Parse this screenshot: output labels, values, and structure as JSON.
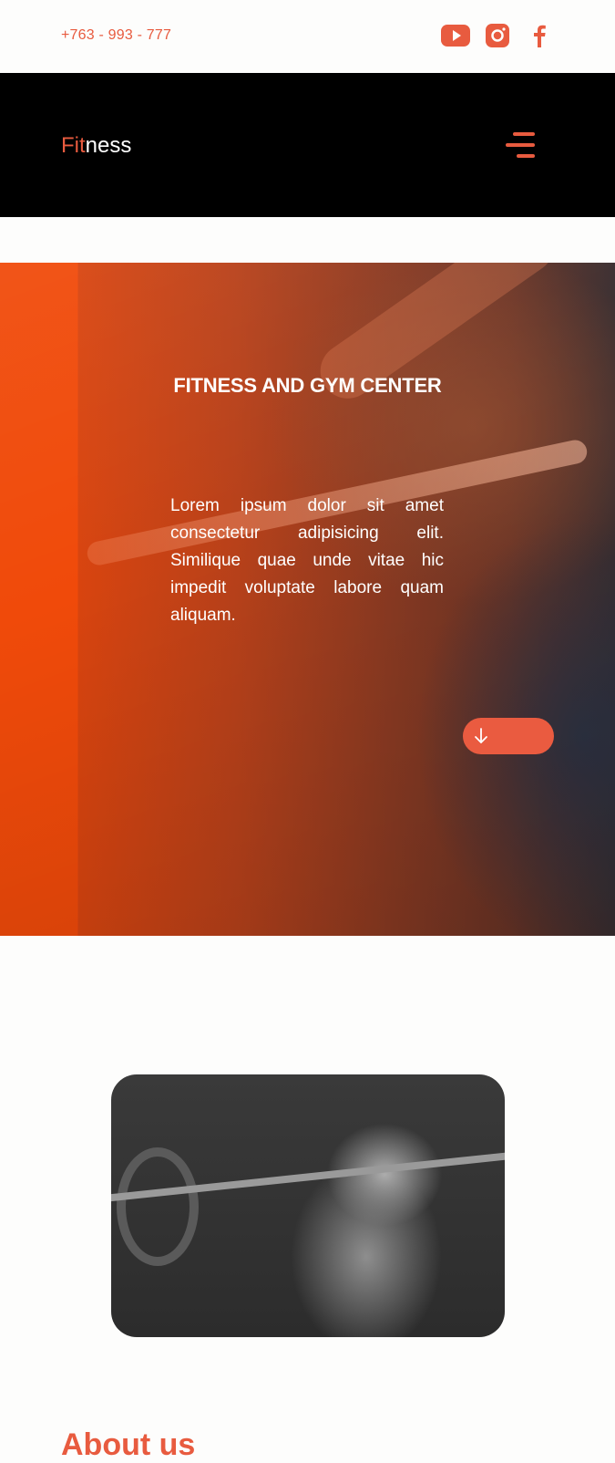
{
  "topbar": {
    "phone": "+763 - 993 - 777",
    "social": [
      {
        "icon": "youtube-icon",
        "color": "#e85b3f"
      },
      {
        "icon": "instagram-icon",
        "color": "#e85b3f"
      },
      {
        "icon": "facebook-icon",
        "color": "#e85b3f"
      }
    ]
  },
  "navbar": {
    "logo_accent": "Fit",
    "logo_rest": "ness",
    "menu_icon": "hamburger-menu-icon"
  },
  "hero": {
    "title": "FITNESS AND GYM CENTER",
    "text": "Lorem ipsum dolor sit amet consectetur adipisicing elit. Similique quae unde vitae hic impedit voluptate labore quam aliquam.",
    "scroll_button_icon": "arrow-down-icon"
  },
  "about": {
    "heading": "About us"
  },
  "colors": {
    "accent": "#e85b3f",
    "navbar_bg": "#000000",
    "page_bg": "#fdfdfc"
  }
}
